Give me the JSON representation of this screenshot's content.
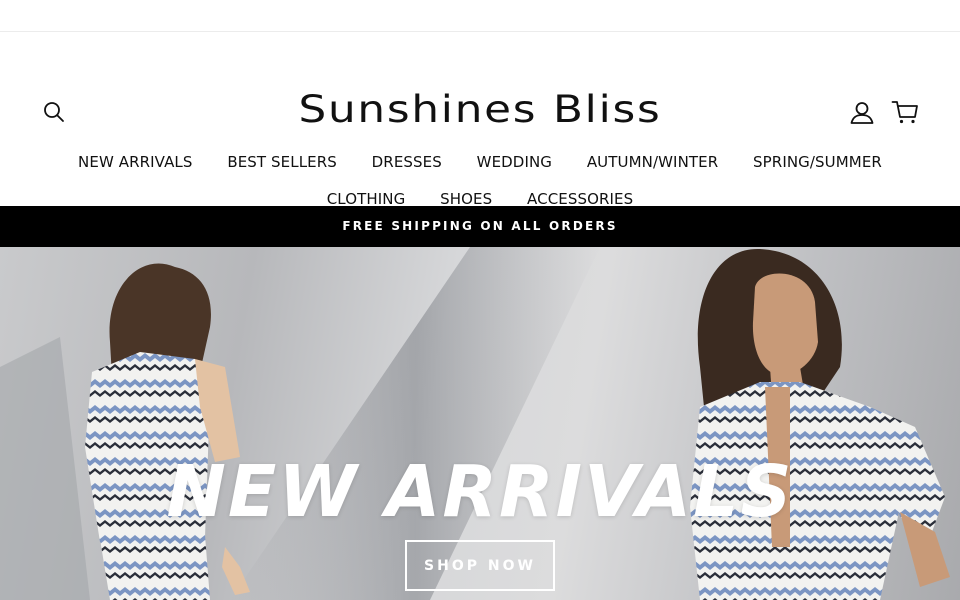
{
  "brand": {
    "name": "Sunshines Bliss"
  },
  "header_icons": {
    "search": "search-icon",
    "account": "user-icon",
    "cart": "cart-icon"
  },
  "nav": {
    "row1": [
      "NEW ARRIVALS",
      "BEST SELLERS",
      "DRESSES",
      "WEDDING",
      "AUTUMN/WINTER",
      "SPRING/SUMMER"
    ],
    "row2": [
      "CLOTHING",
      "SHOES",
      "ACCESSORIES"
    ]
  },
  "announcement": {
    "text": "FREE SHIPPING ON ALL ORDERS"
  },
  "hero": {
    "title": "NEW ARRIVALS",
    "button": "SHOP NOW"
  },
  "colors": {
    "announcement_bg": "#000000",
    "stripe_blue": "#7b95c3",
    "stripe_dark": "#2b2f3a"
  }
}
